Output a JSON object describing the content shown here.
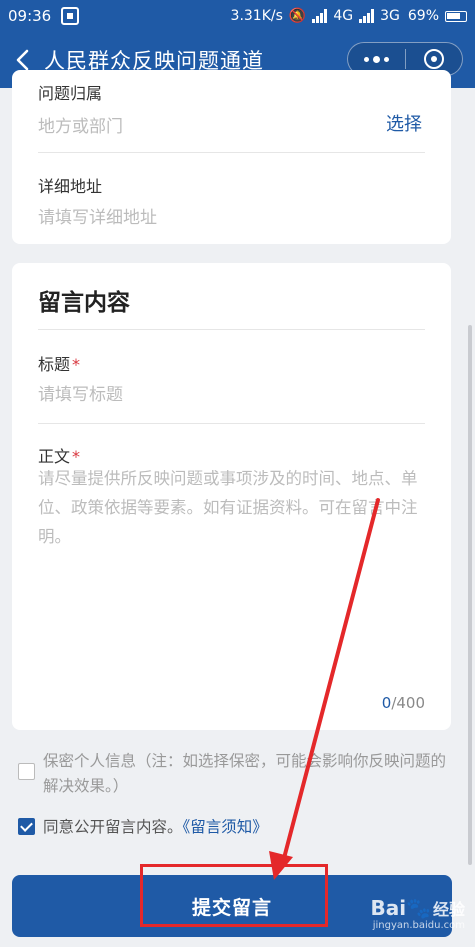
{
  "status_bar": {
    "time": "09:36",
    "speed": "3.31K/s",
    "network_a": "4G",
    "network_b": "3G",
    "battery": "69%"
  },
  "title_bar": {
    "title": "人民群众反映问题通道"
  },
  "location_card": {
    "ownership_label": "问题归属",
    "ownership_placeholder": "地方或部门",
    "select_label": "选择",
    "address_label": "详细地址",
    "address_placeholder": "请填写详细地址"
  },
  "message_card": {
    "section_title": "留言内容",
    "title_label": "标题",
    "title_placeholder": "请填写标题",
    "body_label": "正文",
    "body_placeholder": "请尽量提供所反映问题或事项涉及的时间、地点、单位、政策依据等要素。如有证据资料。可在留言中注明。",
    "char_count": "0",
    "char_max": "/400",
    "required_mark": "*"
  },
  "options": {
    "privacy_text": "保密个人信息（注：如选择保密，可能会影响你反映问题的解决效果。）",
    "privacy_checked": false,
    "public_text": "同意公开留言内容。",
    "notice_link": "《留言须知》",
    "public_checked": true
  },
  "submit": {
    "label": "提交留言"
  },
  "watermark": {
    "brand": "Bai",
    "brand_suffix": "经验",
    "url": "jingyan.baidu.com"
  },
  "colors": {
    "primary": "#1f5aa6",
    "annotation": "#e4282a"
  }
}
